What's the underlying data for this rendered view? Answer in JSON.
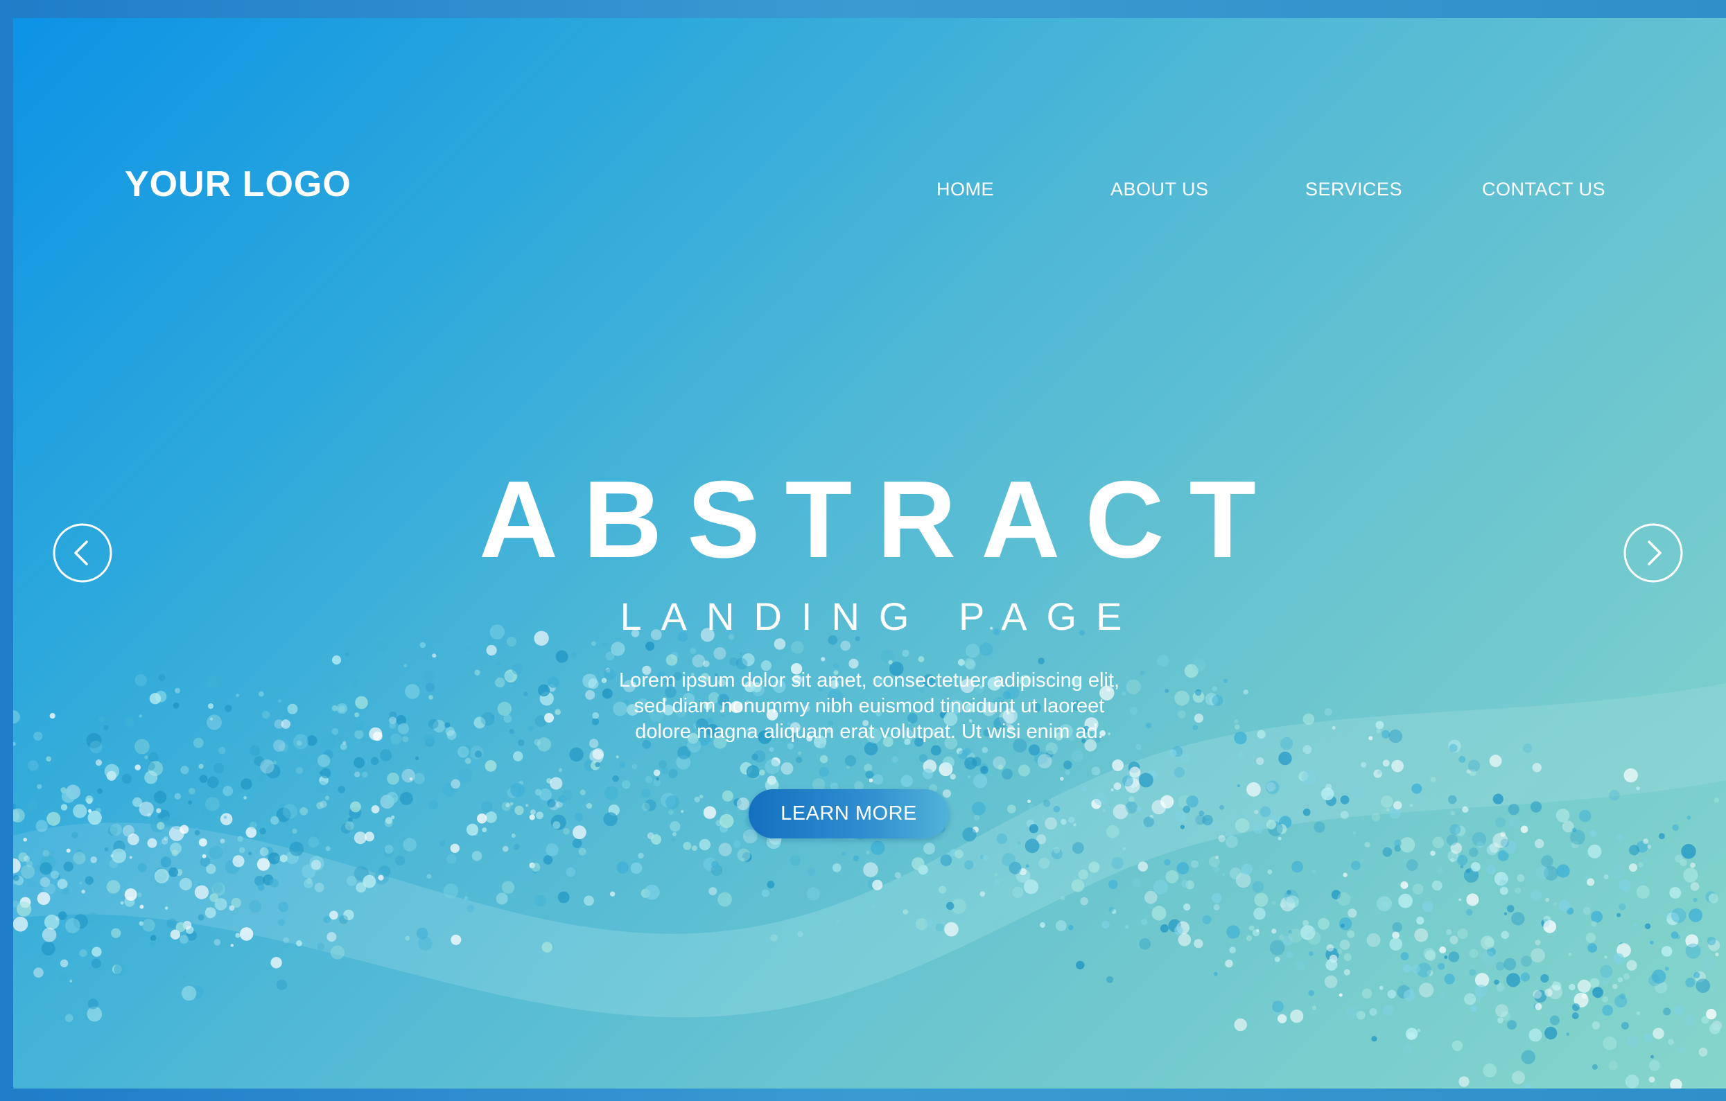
{
  "header": {
    "logo": "YOUR LOGO",
    "nav": [
      {
        "label": "HOME"
      },
      {
        "label": "ABOUT US"
      },
      {
        "label": "SERVICES"
      },
      {
        "label": "CONTACT US"
      }
    ]
  },
  "hero": {
    "title": "ABSTRACT",
    "subtitle": "LANDING PAGE",
    "description_lines": [
      "Lorem ipsum dolor sit amet, consectetuer adipiscing elit,",
      "sed diam nonummy nibh euismod tincidunt ut laoreet",
      "dolore magna aliquam erat volutpat. Ut wisi enim ad."
    ],
    "cta_label": "LEARN MORE"
  },
  "carousel": {
    "prev_icon": "chevron-left-icon",
    "next_icon": "chevron-right-icon"
  },
  "colors": {
    "background_start": "#0d93e6",
    "background_end": "#86d5cb",
    "cta_start": "#1470c0",
    "cta_end": "#51b3d8",
    "text": "#ffffff"
  }
}
